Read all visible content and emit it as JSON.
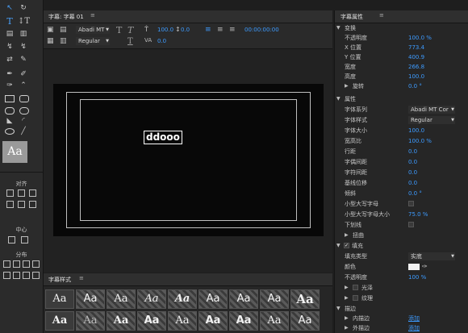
{
  "titlebar": {
    "title": "字幕: 字幕 01",
    "menu": "≡"
  },
  "toolbar": {
    "font_family": "Abadi MT",
    "font_style": "Regular",
    "font_size_value": "100.0",
    "kerning_value": "0.0",
    "leading_value": "0.0",
    "timecode": "00:00:00:00"
  },
  "canvas": {
    "text": "ddooo"
  },
  "tools": {
    "align_label": "对齐",
    "center_label": "中心",
    "distribute_label": "分布",
    "style_preview": "Aa"
  },
  "styles_panel": {
    "title": "字幕样式",
    "menu": "≡",
    "tiles_row1": [
      "Aa",
      "Aa",
      "Aa",
      "Aa",
      "Aa",
      "Aa",
      "Aa",
      "Aa",
      "Aa"
    ],
    "tiles_row2": [
      "Aa",
      "Aa",
      "Aa",
      "Aa",
      "Aa",
      "Aa",
      "Aa",
      "Aa",
      "Aa"
    ]
  },
  "properties": {
    "title": "字幕属性",
    "menu": "≡",
    "rows": [
      {
        "label": "变换",
        "type": "section"
      },
      {
        "label": "不透明度",
        "value": "100.0 %"
      },
      {
        "label": "X 位置",
        "value": "773.4"
      },
      {
        "label": "Y 位置",
        "value": "400.9"
      },
      {
        "label": "宽度",
        "value": "266.8"
      },
      {
        "label": "高度",
        "value": "100.0"
      },
      {
        "label": "旋转",
        "value": "0.0 °",
        "sub": true
      },
      {
        "label": "属性",
        "type": "section"
      },
      {
        "label": "字体系列",
        "dropdown": "Abadi MT Cor"
      },
      {
        "label": "字体样式",
        "dropdown": "Regular"
      },
      {
        "label": "字体大小",
        "value": "100.0"
      },
      {
        "label": "宽高比",
        "value": "100.0 %"
      },
      {
        "label": "行距",
        "value": "0.0"
      },
      {
        "label": "字偶间距",
        "value": "0.0"
      },
      {
        "label": "字符间距",
        "value": "0.0"
      },
      {
        "label": "基线位移",
        "value": "0.0"
      },
      {
        "label": "倾斜",
        "value": "0.0 °"
      },
      {
        "label": "小型大写字母",
        "checkbox": true
      },
      {
        "label": "小型大写字母大小",
        "value": "75.0 %"
      },
      {
        "label": "下划线",
        "checkbox": true
      },
      {
        "label": "扭曲",
        "type": "sub-section"
      },
      {
        "label": "填充",
        "type": "section-check"
      },
      {
        "label": "填充类型",
        "dropdown": "实底"
      },
      {
        "label": "颜色",
        "color": "#f2f2f2"
      },
      {
        "label": "不透明度",
        "value": "100 %"
      },
      {
        "label": "光泽",
        "type": "sub-check"
      },
      {
        "label": "纹理",
        "type": "sub-check"
      },
      {
        "label": "描边",
        "type": "section"
      },
      {
        "label": "内描边",
        "link": "添加"
      },
      {
        "label": "外描边",
        "link": "添加"
      },
      {
        "label": "阴影",
        "type": "sub-check"
      }
    ]
  },
  "colors": {
    "accent": "#3d9bff",
    "panel": "#262626",
    "canvas": "#080808"
  }
}
